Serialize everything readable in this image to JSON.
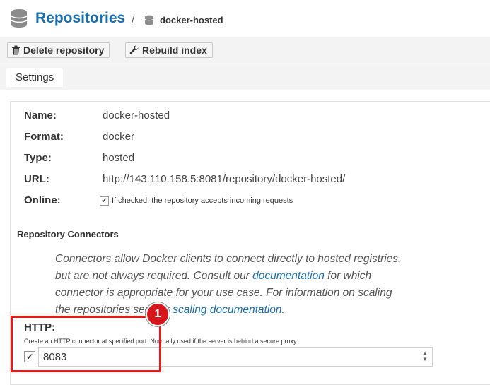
{
  "header": {
    "title": "Repositories",
    "separator": "/",
    "crumb": "docker-hosted"
  },
  "toolbar": {
    "delete_label": "Delete repository",
    "rebuild_label": "Rebuild index"
  },
  "tabs": [
    {
      "label": "Settings"
    }
  ],
  "details": {
    "name_label": "Name:",
    "name_value": "docker-hosted",
    "format_label": "Format:",
    "format_value": "docker",
    "type_label": "Type:",
    "type_value": "hosted",
    "url_label": "URL:",
    "url_value": "http://143.110.158.5:8081/repository/docker-hosted/",
    "online_label": "Online:",
    "online_checked": true,
    "online_hint": "If checked, the repository accepts incoming requests"
  },
  "connectors": {
    "heading": "Repository Connectors",
    "para_1": "Connectors allow Docker clients to connect directly to hosted registries, but are not always required. Consult our ",
    "para_link_1": "documentation",
    "para_2": " for which connector is appropriate for your use case. For information on scaling the repositories see our ",
    "para_link_2": "scaling documentation",
    "para_3": ".",
    "http_label": "HTTP:",
    "http_hint": "Create an HTTP connector at specified port. Normally used if the server is behind a secure proxy.",
    "http_checked": true,
    "http_port": "8083"
  },
  "annotation": {
    "badge": "1",
    "color": "#e11b1b"
  },
  "colors": {
    "accent": "#1a6fb0",
    "highlight": "#e11b1b",
    "strip": "#5aab4e"
  }
}
